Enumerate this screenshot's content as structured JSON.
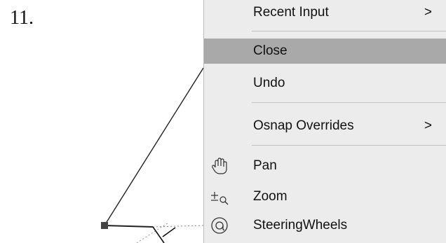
{
  "step_number": "11.",
  "menu": {
    "items": [
      {
        "label": "Recent Input",
        "arrow": ">"
      },
      {
        "label": "Close"
      },
      {
        "label": "Undo"
      },
      {
        "label": "Osnap Overrides",
        "arrow": ">"
      },
      {
        "label": "Pan",
        "icon": "pan-hand-icon"
      },
      {
        "label": "Zoom",
        "icon": "zoom-icon"
      },
      {
        "label": "SteeringWheels",
        "icon": "steering-wheels-icon"
      }
    ],
    "highlighted": "Close"
  },
  "colors": {
    "menu_background": "#ececec",
    "highlight": "#a9a9a9",
    "separator": "#c4c4c4"
  }
}
